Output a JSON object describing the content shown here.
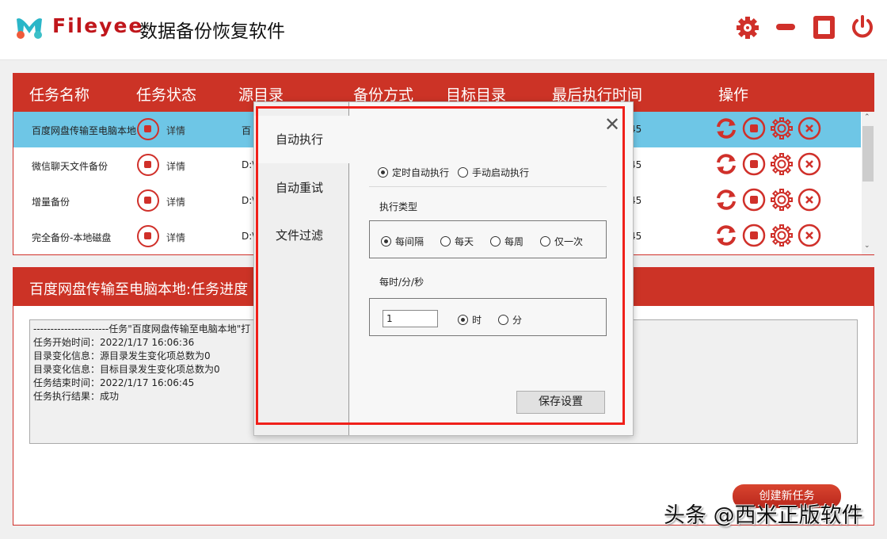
{
  "header": {
    "brand": "Fileyee",
    "title": "数据备份恢复软件"
  },
  "table": {
    "columns": [
      "任务名称",
      "任务状态",
      "源目录",
      "备份方式",
      "目标目录",
      "最后执行时间",
      "操作"
    ],
    "rows": [
      {
        "name": "百度网盘传输至电脑本地",
        "detail": "详情",
        "source": "百",
        "time": "45"
      },
      {
        "name": "微信聊天文件备份",
        "detail": "详情",
        "source": "D:\\",
        "time": "45"
      },
      {
        "name": "增量备份",
        "detail": "详情",
        "source": "D:\\",
        "time": "45"
      },
      {
        "name": "完全备份-本地磁盘",
        "detail": "详情",
        "source": "D:\\",
        "time": "45"
      }
    ]
  },
  "progress": {
    "title": "百度网盘传输至电脑本地:任务进度",
    "log": [
      "----------------------任务\"百度网盘传输至电脑本地\"打",
      "任务开始时间：2022/1/17 16:06:36",
      "目录变化信息：源目录发生变化项总数为0",
      "目录变化信息：目标目录发生变化项总数为0",
      "任务结束时间：2022/1/17 16:06:45",
      "任务执行结果：成功"
    ],
    "create_label": "创建新任务"
  },
  "dialog": {
    "nav": [
      "自动执行",
      "自动重试",
      "文件过滤"
    ],
    "mode": {
      "options": [
        "定时自动执行",
        "手动启动执行"
      ],
      "selected": "定时自动执行"
    },
    "type_label": "执行类型",
    "types": [
      "每间隔",
      "每天",
      "每周",
      "仅一次"
    ],
    "type_selected": "每间隔",
    "interval_label": "每时/分/秒",
    "interval_value": "1",
    "units": [
      "时",
      "分"
    ],
    "unit_selected": "时",
    "save_label": "保存设置"
  },
  "watermark": "头条 @西米正版软件",
  "colors": {
    "accent": "#cc3326",
    "selected_row": "#6ec6e6"
  }
}
